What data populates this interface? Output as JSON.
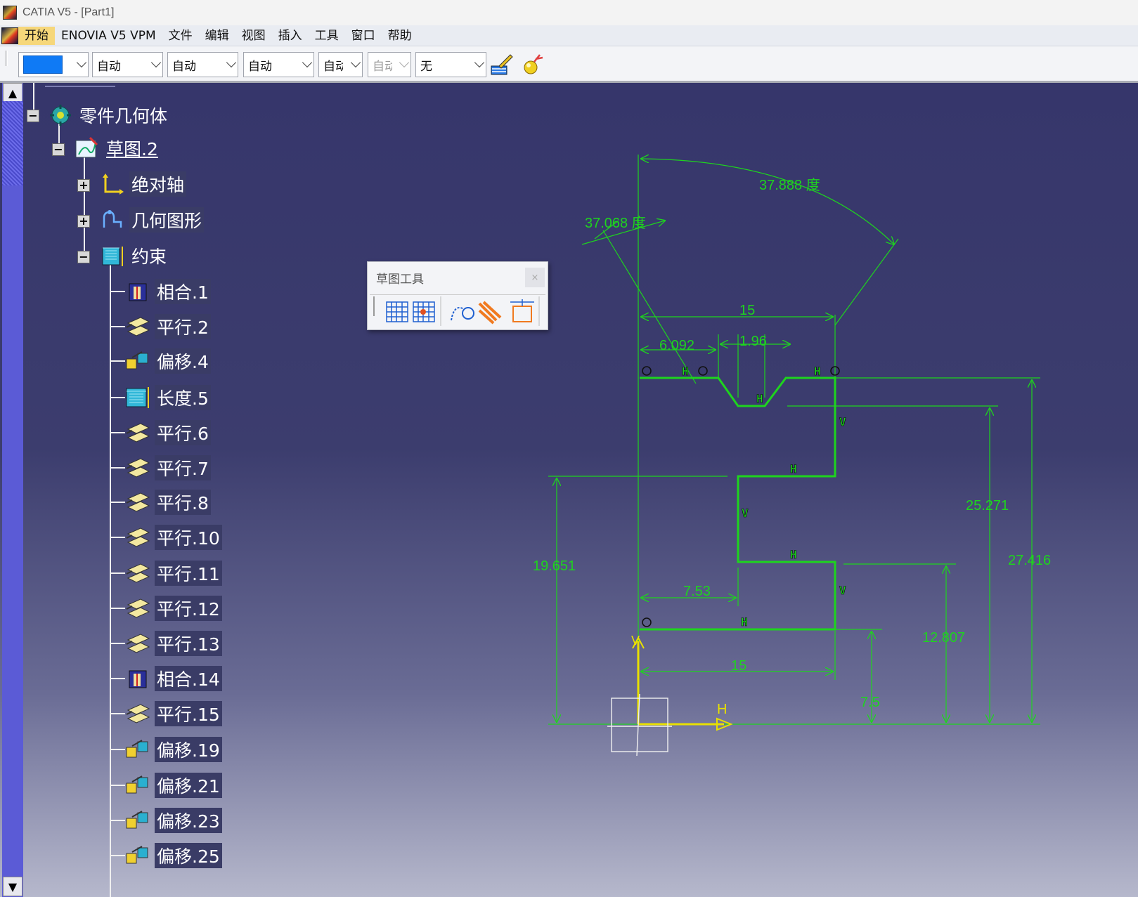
{
  "window": {
    "title": "CATIA V5 - [Part1]"
  },
  "menu": {
    "items": [
      "开始",
      "ENOVIA V5 VPM",
      "文件",
      "编辑",
      "视图",
      "插入",
      "工具",
      "窗口",
      "帮助"
    ]
  },
  "toolbar": {
    "color_swatch": "#0f7af5",
    "combos": [
      "自动",
      "自动",
      "自动",
      "自动",
      "自动",
      "无"
    ]
  },
  "palette": {
    "title": "草图工具",
    "close": "×"
  },
  "tree": {
    "root": "零件几何体",
    "sketch": "草图.2",
    "children": [
      "绝对轴",
      "几何图形",
      "约束"
    ],
    "constraints": [
      "相合.1",
      "平行.2",
      "偏移.4",
      "长度.5",
      "平行.6",
      "平行.7",
      "平行.8",
      "平行.10",
      "平行.11",
      "平行.12",
      "平行.13",
      "相合.14",
      "平行.15",
      "偏移.19",
      "偏移.21",
      "偏移.23",
      "偏移.25"
    ]
  },
  "dimensions": {
    "angle_top": "37.888 度",
    "angle_left": "37.068 度",
    "width_top": "15",
    "d_6092": "6.092",
    "d_196": "1.96",
    "d_19651": "19.651",
    "d_25271": "25.271",
    "d_27416": "27.416",
    "d_753": "7.53",
    "d_12807": "12.807",
    "width_bottom": "15",
    "d_75": "7.5"
  },
  "axis": {
    "h_label": "H",
    "v_label": "V"
  },
  "constraint_marks": {
    "h": "H",
    "v": "V"
  },
  "colors": {
    "sketch": "#1ed41e",
    "axis": "#e8e000",
    "background": "#3a3b6c"
  }
}
